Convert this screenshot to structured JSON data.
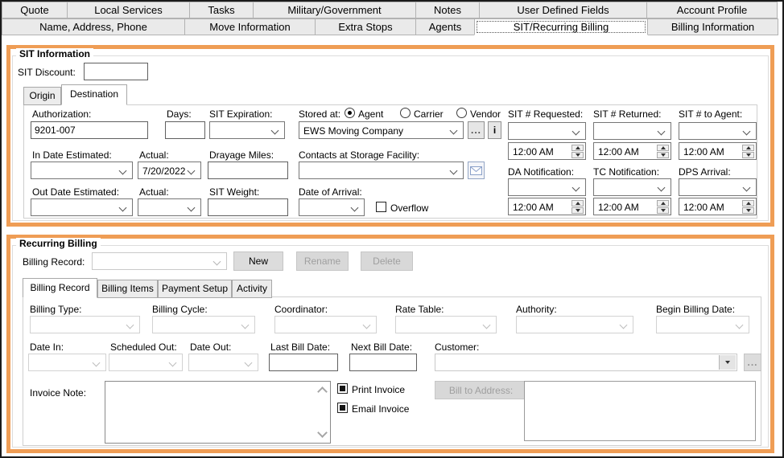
{
  "tabs": {
    "row1": [
      {
        "label": "Quote"
      },
      {
        "label": "Local Services"
      },
      {
        "label": "Tasks"
      },
      {
        "label": "Military/Government"
      },
      {
        "label": "Notes"
      },
      {
        "label": "User Defined Fields"
      },
      {
        "label": "Account Profile"
      }
    ],
    "row2": [
      {
        "label": "Name, Address, Phone"
      },
      {
        "label": "Move Information"
      },
      {
        "label": "Extra Stops"
      },
      {
        "label": "Agents"
      },
      {
        "label": "SIT/Recurring Billing"
      },
      {
        "label": "Billing Information"
      }
    ],
    "active": "SIT/Recurring Billing"
  },
  "sit": {
    "title": "SIT Information",
    "discount_label": "SIT Discount:",
    "discount_value": "",
    "tabs": {
      "origin": "Origin",
      "destination": "Destination",
      "active": "Destination"
    },
    "authorization_label": "Authorization:",
    "authorization_value": "9201-007",
    "days_label": "Days:",
    "days_value": "",
    "expiration_label": "SIT Expiration:",
    "stored_at_label": "Stored at:",
    "stored_at": {
      "options": [
        {
          "label": "Agent",
          "selected": true
        },
        {
          "label": "Carrier",
          "selected": false
        },
        {
          "label": "Vendor",
          "selected": false
        }
      ],
      "value": "EWS Moving Company"
    },
    "more_button": "...",
    "info_button": "i",
    "requested_label": "SIT # Requested:",
    "requested_time": "12:00 AM",
    "returned_label": "SIT # Returned:",
    "returned_time": "12:00 AM",
    "to_agent_label": "SIT # to Agent:",
    "to_agent_time": "12:00 AM",
    "in_date_estimated_label": "In Date Estimated:",
    "in_actual_label": "Actual:",
    "in_actual_value": "7/20/2022",
    "drayage_label": "Drayage Miles:",
    "drayage_value": "",
    "contacts_label": "Contacts at Storage Facility:",
    "da_label": "DA Notification:",
    "da_time": "12:00 AM",
    "tc_label": "TC Notification:",
    "tc_time": "12:00 AM",
    "dps_label": "DPS Arrival:",
    "dps_time": "12:00 AM",
    "out_date_estimated_label": "Out Date Estimated:",
    "out_actual_label": "Actual:",
    "weight_label": "SIT Weight:",
    "weight_value": "",
    "arrival_label": "Date of Arrival:",
    "overflow_label": "Overflow",
    "overflow_checked": false
  },
  "recurring": {
    "title": "Recurring Billing",
    "record_label": "Billing Record:",
    "record_value": "",
    "new_button": "New",
    "rename_button": "Rename",
    "delete_button": "Delete",
    "tabs": [
      {
        "label": "Billing Record"
      },
      {
        "label": "Billing Items"
      },
      {
        "label": "Payment Setup"
      },
      {
        "label": "Activity"
      }
    ],
    "active_tab": "Billing Record",
    "type_label": "Billing Type:",
    "cycle_label": "Billing Cycle:",
    "coordinator_label": "Coordinator:",
    "rate_label": "Rate Table:",
    "authority_label": "Authority:",
    "begin_label": "Begin Billing Date:",
    "date_in_label": "Date In:",
    "scheduled_out_label": "Scheduled Out:",
    "date_out_label": "Date Out:",
    "last_bill_label": "Last Bill Date:",
    "last_bill_value": "",
    "next_bill_label": "Next Bill Date:",
    "next_bill_value": "",
    "customer_label": "Customer:",
    "customer_value": "",
    "browse_button": "...",
    "invoice_note_label": "Invoice Note:",
    "invoice_note_value": "",
    "print_label": "Print Invoice",
    "print_checked": true,
    "email_label": "Email Invoice",
    "email_checked": true,
    "bill_to_button": "Bill to Address:"
  },
  "colors": {
    "accent_orange": "#EF9D55"
  }
}
